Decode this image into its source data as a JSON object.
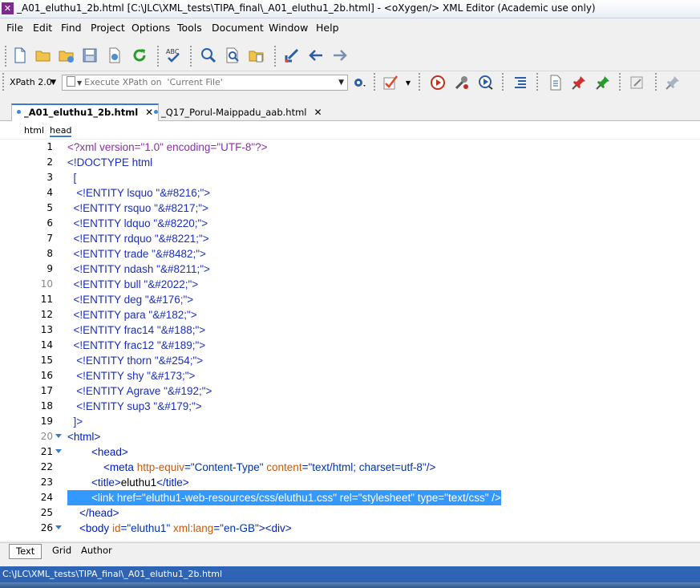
{
  "window": {
    "title": "_A01_eluthu1_2b.html [C:\\JLC\\XML_tests\\TIPA_final\\_A01_eluthu1_2b.html] - <oXygen/> XML Editor (Academic use only)"
  },
  "menu": [
    "File",
    "Edit",
    "Find",
    "Project",
    "Options",
    "Tools",
    "Document",
    "Window",
    "Help"
  ],
  "toolbar": {
    "spell_label": "ABC"
  },
  "xpath": {
    "version": "XPath 2.0",
    "placeholder": "Execute XPath on  'Current File'"
  },
  "tabs": [
    {
      "label": "_A01_eluthu1_2b.html",
      "active": true
    },
    {
      "label": "_Q17_Porul-Maippadu_aab.html",
      "active": false
    }
  ],
  "close_glyph": "✕",
  "breadcrumb": [
    "html",
    "head"
  ],
  "lines": [
    {
      "n": "1",
      "html": "<span class=\"p\">&lt;?xml version=\"1.0\" encoding=\"UTF-8\"?&gt;</span>"
    },
    {
      "n": "2",
      "html": "<span class=\"d\">&lt;!DOCTYPE html</span>"
    },
    {
      "n": "3",
      "html": "<span class=\"d\">  [</span>"
    },
    {
      "n": "4",
      "html": "<span class=\"d\">   &lt;!ENTITY lsquo \"&amp;#8216;\"&gt;</span>"
    },
    {
      "n": "5",
      "html": "<span class=\"d\">  &lt;!ENTITY rsquo \"&amp;#8217;\"&gt;</span>"
    },
    {
      "n": "6",
      "html": "<span class=\"d\">  &lt;!ENTITY ldquo \"&amp;#8220;\"&gt;</span>"
    },
    {
      "n": "7",
      "html": "<span class=\"d\">  &lt;!ENTITY rdquo \"&amp;#8221;\"&gt;</span>"
    },
    {
      "n": "8",
      "html": "<span class=\"d\">  &lt;!ENTITY trade \"&amp;#8482;\"&gt;</span>"
    },
    {
      "n": "9",
      "html": "<span class=\"d\">  &lt;!ENTITY ndash \"&amp;#8211;\"&gt;</span>"
    },
    {
      "n": "10",
      "dim": true,
      "html": "<span class=\"d\">  &lt;!ENTITY bull \"&amp;#2022;\"&gt;</span>"
    },
    {
      "n": "11",
      "html": "<span class=\"d\">  &lt;!ENTITY deg \"&amp;#176;\"&gt;</span>"
    },
    {
      "n": "12",
      "html": "<span class=\"d\">  &lt;!ENTITY para \"&amp;#182;\"&gt;</span>"
    },
    {
      "n": "13",
      "html": "<span class=\"d\">  &lt;!ENTITY frac14 \"&amp;#188;\"&gt;</span>"
    },
    {
      "n": "14",
      "html": "<span class=\"d\">  &lt;!ENTITY frac12 \"&amp;#189;\"&gt;</span>"
    },
    {
      "n": "15",
      "html": "<span class=\"d\">   &lt;!ENTITY thorn \"&amp;#254;\"&gt;</span>"
    },
    {
      "n": "16",
      "html": "<span class=\"d\">   &lt;!ENTITY shy \"&amp;#173;\"&gt;</span>"
    },
    {
      "n": "17",
      "html": "<span class=\"d\">   &lt;!ENTITY Agrave \"&amp;#192;\"&gt;</span>"
    },
    {
      "n": "18",
      "html": "<span class=\"d\">   &lt;!ENTITY sup3 \"&amp;#179;\"&gt;</span>"
    },
    {
      "n": "19",
      "html": "<span class=\"d\">  ]&gt;</span>"
    },
    {
      "n": "20",
      "dim": true,
      "fold": true,
      "html": "<span class=\"b\">&lt;html&gt;</span>"
    },
    {
      "n": "21",
      "fold": true,
      "html": "        <span class=\"b\">&lt;head&gt;</span>"
    },
    {
      "n": "22",
      "html": "            <span class=\"b\">&lt;meta</span> <span class=\"a\">http-equiv</span><span class=\"b\">=</span><span class=\"v\">\"Content-Type\"</span> <span class=\"a\">content</span><span class=\"b\">=</span><span class=\"v\">\"text/html; charset=utf-8\"</span><span class=\"b\">/&gt;</span>"
    },
    {
      "n": "23",
      "html": "        <span class=\"b\">&lt;title&gt;</span><span class=\"t\">eluthu1</span><span class=\"b\">&lt;/title&gt;</span>"
    },
    {
      "n": "24",
      "selected": true,
      "html": "        &lt;link href=\"eluthu1-web-resources/css/eluthu1.css\" rel=\"stylesheet\" type=\"text/css\" /&gt;"
    },
    {
      "n": "25",
      "html": "    <span class=\"b\">&lt;/head&gt;</span>"
    },
    {
      "n": "26",
      "fold": true,
      "html": "    <span class=\"b\">&lt;body</span> <span class=\"a\">id</span><span class=\"b\">=</span><span class=\"v\">\"eluthu1\"</span> <span class=\"a\">xml:lang</span><span class=\"b\">=</span><span class=\"v\">\"en-GB\"</span><span class=\"b\">&gt;&lt;div&gt;</span>"
    }
  ],
  "modes": [
    {
      "label": "Text",
      "active": true
    },
    {
      "label": "Grid",
      "active": false
    },
    {
      "label": "Author",
      "active": false
    }
  ],
  "status": {
    "path": "C:\\JLC\\XML_tests\\TIPA_final\\_A01_eluthu1_2b.html"
  },
  "colors": {
    "accent": "#3399ff",
    "status_bar": "#2f64b4",
    "pi": "#8b2fa8",
    "tag": "#0020c0",
    "attribute": "#c55a11"
  }
}
